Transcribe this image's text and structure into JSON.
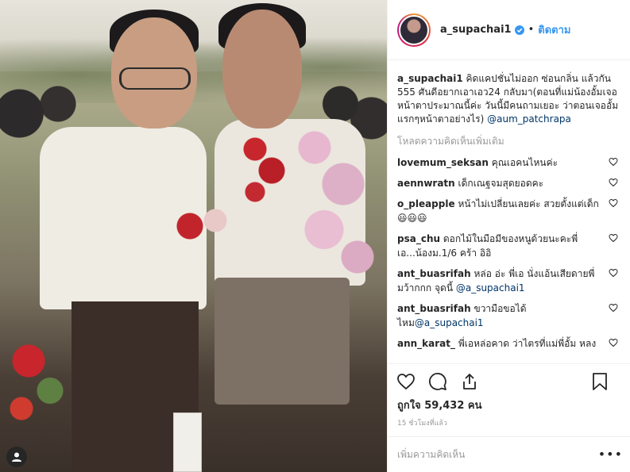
{
  "post": {
    "username": "a_supachai1",
    "follow_label": "ติดตาม",
    "caption_user": "a_supachai1",
    "caption_text": "คิดแคปชั่นไม่ออก ซ่อนกลิ่น แล้วกัน 555 ศันดีอยากเอาเอว24 กลับมา(ตอนที่แม่น้องอั้มเจอ หน้าตาประมาณนี้ค่ะ วันนี้มีคนถามเยอะ ว่าตอนเจออั้มแรกๆหน้าตาอย่างไร)",
    "caption_mention": "@aum_patchrapa",
    "load_more": "โหลดความคิดเห็นเพิ่มเติม",
    "comments": [
      {
        "user": "lovemum_seksan",
        "text": "คุณเอคนไหนค่ะ"
      },
      {
        "user": "aennwratn",
        "text": "เด็กเณฐจมสุดยอดคะ"
      },
      {
        "user": "o_pleapple",
        "text": "หน้าไม่เปลี่ยนเลยค่ะ สวยตั้งแต่เด็ก😃😃😃"
      },
      {
        "user": "psa_chu",
        "text": "ดอกไม้ในมือมีของหนูด้วยนะคะพี่เอ...น้องม.1/6 คร้า อิอิ"
      },
      {
        "user": "ant_buasrifah",
        "text": "หล่อ อ่ะ พี่เอ นั่งแอ้นเสียดายพี่มว้ากกก จุดนี้ ",
        "mention": "@a_supachai1"
      },
      {
        "user": "ant_buasrifah",
        "text": "ขวามือขอได้ไหม",
        "mention": "@a_supachai1"
      },
      {
        "user": "ann_karat_",
        "text": "พี่เอหล่อคาด ว่าไตรที่แม่พี่อั้ม หลง"
      }
    ],
    "likes": "ถูกใจ 59,432 คน",
    "time": "15 ชั่วโมงที่แล้ว",
    "add_comment_placeholder": "เพิ่มความคิดเห็น",
    "more_label": "•••"
  },
  "colors": {
    "accent": "#3897f0",
    "mention": "#003569",
    "muted": "#999999",
    "text": "#262626"
  },
  "icons": [
    "verified-icon",
    "heart-icon",
    "comment-icon",
    "share-icon",
    "bookmark-icon",
    "more-icon",
    "user-avatar-icon"
  ]
}
